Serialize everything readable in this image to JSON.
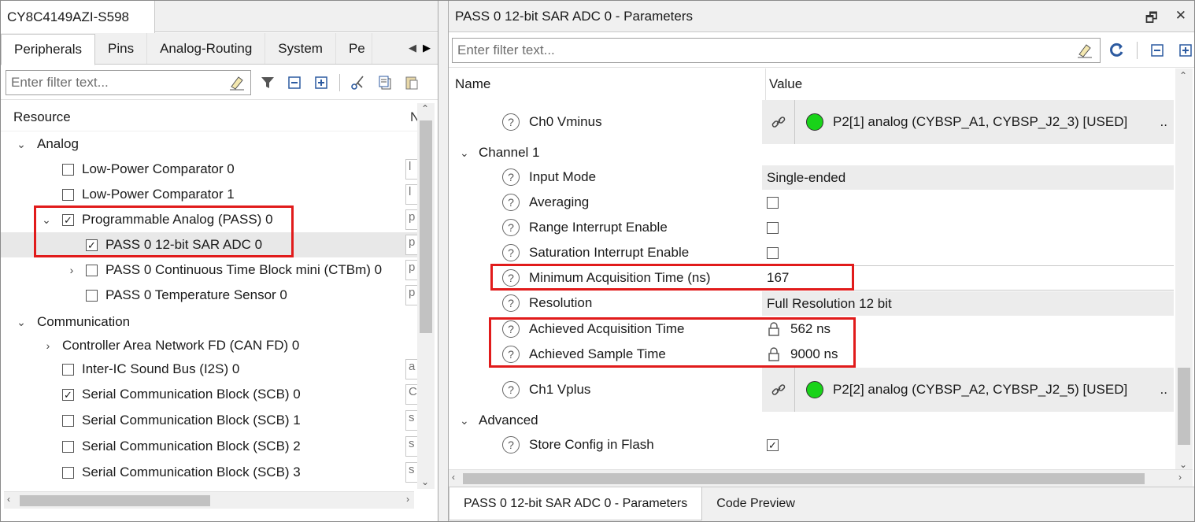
{
  "left": {
    "title": "CY8C4149AZI-S598",
    "tabs": [
      {
        "label": "Peripherals",
        "active": true
      },
      {
        "label": "Pins"
      },
      {
        "label": "Analog-Routing"
      },
      {
        "label": "System"
      },
      {
        "label": "Pe"
      }
    ],
    "filter_placeholder": "Enter filter text...",
    "column_header": "Resource",
    "column_header_2": "N",
    "tree": [
      {
        "label": "Analog",
        "type": "group",
        "expanded": true
      },
      {
        "label": "Low-Power Comparator 0",
        "checked": false,
        "value": "l"
      },
      {
        "label": "Low-Power Comparator 1",
        "checked": false,
        "value": "l"
      },
      {
        "label": "Programmable Analog (PASS) 0",
        "checked": true,
        "expanded": true,
        "value": "p"
      },
      {
        "label": "PASS 0 12-bit SAR ADC 0",
        "checked": true,
        "selected": true,
        "value": "p"
      },
      {
        "label": "PASS 0 Continuous Time Block mini (CTBm) 0",
        "checked": false,
        "collapsed": true,
        "value": "p"
      },
      {
        "label": "PASS 0 Temperature Sensor 0",
        "checked": false,
        "value": "p"
      },
      {
        "label": "Communication",
        "type": "group",
        "expanded": true
      },
      {
        "label": "Controller Area Network FD (CAN FD) 0",
        "type": "subgroup"
      },
      {
        "label": "Inter-IC Sound Bus (I2S) 0",
        "checked": false,
        "value": "a"
      },
      {
        "label": "Serial Communication Block (SCB) 0",
        "checked": true,
        "value": "C"
      },
      {
        "label": "Serial Communication Block (SCB) 1",
        "checked": false,
        "value": "s"
      },
      {
        "label": "Serial Communication Block (SCB) 2",
        "checked": false,
        "value": "s"
      },
      {
        "label": "Serial Communication Block (SCB) 3",
        "checked": false,
        "value": "s"
      }
    ]
  },
  "right": {
    "title": "PASS 0 12-bit SAR ADC 0 - Parameters",
    "filter_placeholder": "Enter filter text...",
    "col_name": "Name",
    "col_value": "Value",
    "rows": [
      {
        "name": "Ch0 Vminus",
        "value": "P2[1] analog (CYBSP_A1, CYBSP_J2_3) [USED]"
      },
      {
        "group": "Channel 1"
      },
      {
        "name": "Input Mode",
        "value": "Single-ended"
      },
      {
        "name": "Averaging",
        "checkbox": false
      },
      {
        "name": "Range Interrupt Enable",
        "checkbox": false
      },
      {
        "name": "Saturation Interrupt Enable",
        "checkbox": false
      },
      {
        "name": "Minimum Acquisition Time (ns)",
        "value": "167"
      },
      {
        "name": "Resolution",
        "value": "Full Resolution 12 bit"
      },
      {
        "name": "Achieved Acquisition Time",
        "value": "562 ns"
      },
      {
        "name": "Achieved Sample Time",
        "value": "9000 ns"
      },
      {
        "name": "Ch1 Vplus",
        "value": "P2[2] analog (CYBSP_A2, CYBSP_J2_5) [USED]"
      },
      {
        "group": "Advanced"
      },
      {
        "name": "Store Config in Flash",
        "checkbox": true
      }
    ],
    "ellipsis": "..",
    "bottom_tabs": [
      {
        "label": "PASS 0 12-bit SAR ADC 0 - Parameters",
        "active": true
      },
      {
        "label": "Code Preview"
      }
    ]
  },
  "icons": {
    "help": "?",
    "check": "✓",
    "link": "⛓",
    "lock": "🔒",
    "expand": "⌄",
    "collapse": "›"
  },
  "colors": {
    "highlight": "#e11b1b",
    "status_ok": "#19d319",
    "panel_bg": "#f0f0f0",
    "selected_row": "#e8e8e8"
  }
}
